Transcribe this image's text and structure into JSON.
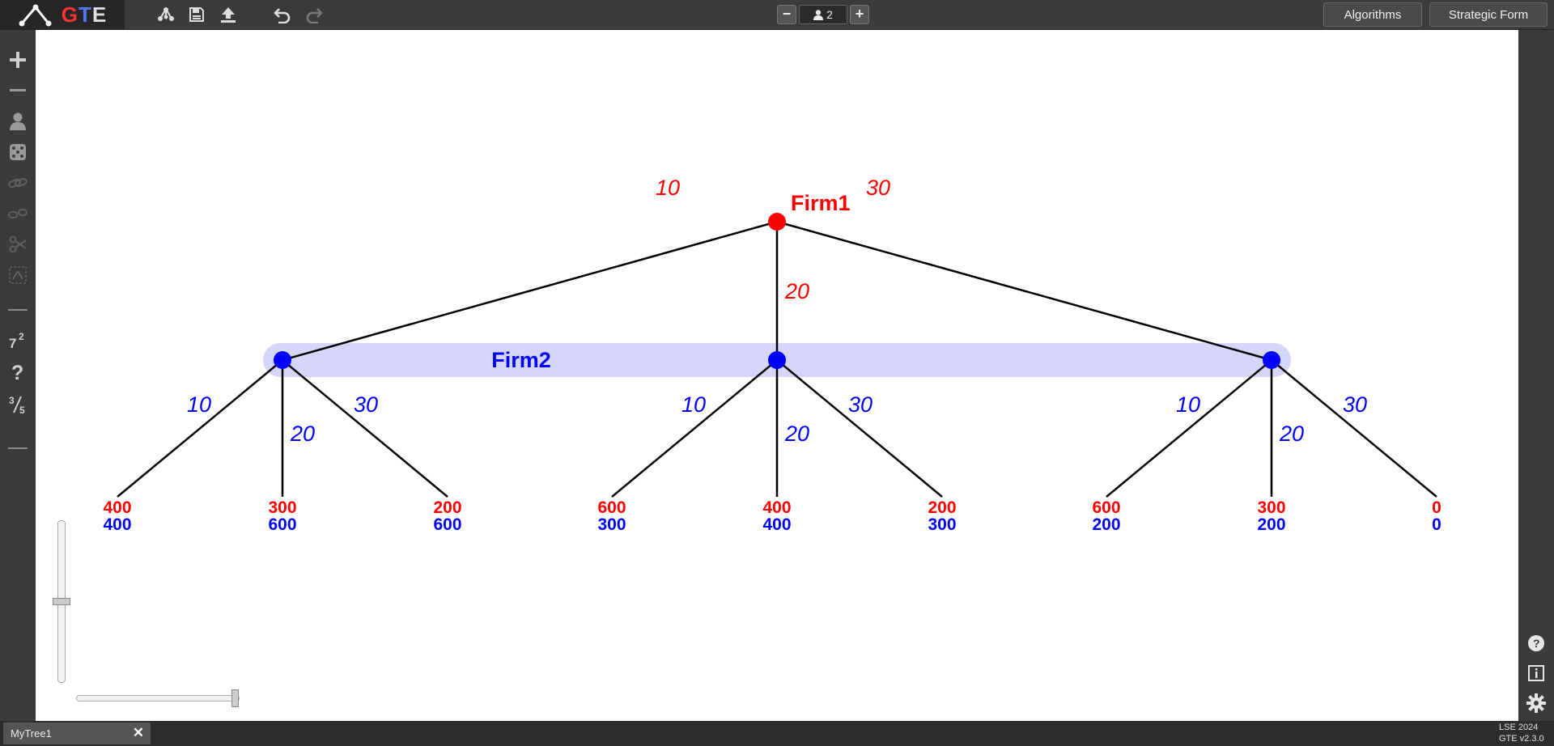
{
  "app": {
    "logo_text_g": "G",
    "logo_text_t": "T",
    "logo_text_e": "E"
  },
  "toolbar": {
    "players_count": "2",
    "algorithms_label": "Algorithms",
    "strategic_form_label": "Strategic Form"
  },
  "tabs": [
    {
      "label": "MyTree1"
    }
  ],
  "version": {
    "line1": "LSE 2024",
    "line2": "GTE v2.3.0"
  },
  "colors": {
    "player1": "#ff0000",
    "player2": "#0000ff",
    "infoset_fill": "#d6d6fb"
  },
  "tree": {
    "root_player": "Firm1",
    "infoset_player": "Firm2",
    "root_moves": [
      "10",
      "20",
      "30"
    ],
    "firm2_moves": [
      [
        "10",
        "20",
        "30"
      ],
      [
        "10",
        "20",
        "30"
      ],
      [
        "10",
        "20",
        "30"
      ]
    ],
    "payoffs": [
      {
        "p1": "400",
        "p2": "400"
      },
      {
        "p1": "300",
        "p2": "600"
      },
      {
        "p1": "200",
        "p2": "600"
      },
      {
        "p1": "600",
        "p2": "300"
      },
      {
        "p1": "400",
        "p2": "400"
      },
      {
        "p1": "200",
        "p2": "300"
      },
      {
        "p1": "600",
        "p2": "200"
      },
      {
        "p1": "300",
        "p2": "200"
      },
      {
        "p1": "0",
        "p2": "0"
      }
    ]
  },
  "sliders": {
    "zoom_vertical_level": 0.5,
    "zoom_horizontal_level": 1.0
  }
}
